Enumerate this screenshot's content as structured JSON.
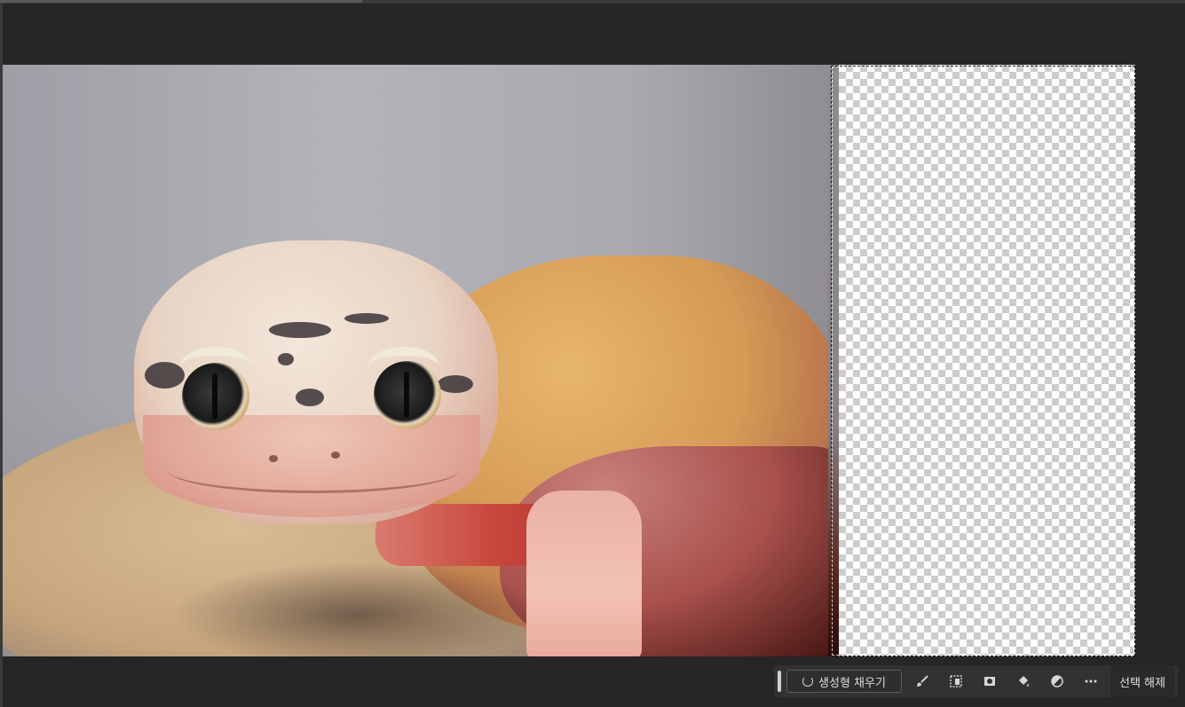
{
  "canvas": {
    "layer": "gecko-photo",
    "transparent_area": "checkerboard"
  },
  "taskbar": {
    "generative_fill_label": "생성형 채우기",
    "tools": [
      {
        "icon": "brush-icon"
      },
      {
        "icon": "select-subject-icon"
      },
      {
        "icon": "mask-icon"
      },
      {
        "icon": "fill-bucket-icon"
      },
      {
        "icon": "adjustment-icon"
      },
      {
        "icon": "more-icon"
      }
    ],
    "deselect_label": "선택 해제"
  }
}
